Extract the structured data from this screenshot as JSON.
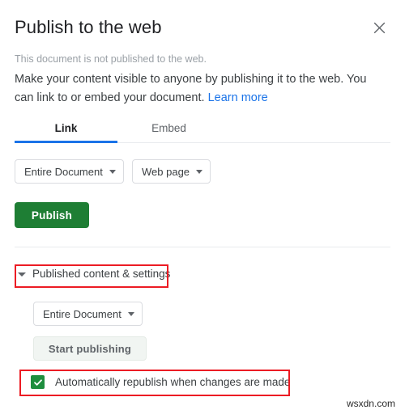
{
  "dialog": {
    "title": "Publish to the web",
    "close_icon": "close-icon",
    "status_text": "This document is not published to the web.",
    "description_text": "Make your content visible to anyone by publishing it to the web. You can link to or embed your document. ",
    "learn_more_label": "Learn more"
  },
  "tabs": [
    {
      "label": "Link",
      "active": true
    },
    {
      "label": "Embed",
      "active": false
    }
  ],
  "link_tab": {
    "scope_dropdown": {
      "label": "Entire Document",
      "icon": "chevron-down-icon"
    },
    "format_dropdown": {
      "label": "Web page",
      "icon": "chevron-down-icon"
    },
    "publish_button": {
      "label": "Publish",
      "color": "#1e7e34"
    }
  },
  "published_section": {
    "toggle_label": "Published content & settings",
    "disclosure_icon": "triangle-down-icon",
    "scope_dropdown": {
      "label": "Entire Document",
      "icon": "chevron-down-icon"
    },
    "start_publishing_button": {
      "label": "Start publishing"
    },
    "auto_republish": {
      "label": "Automatically republish when changes are made",
      "checked": true,
      "check_color": "#1e8e3e"
    }
  },
  "annotations": {
    "color": "#ec1c24",
    "boxes": [
      {
        "target": "published-content-settings-toggle"
      },
      {
        "target": "auto-republish-checkbox-row"
      }
    ]
  },
  "watermark": {
    "text": "wsxdn.com"
  }
}
